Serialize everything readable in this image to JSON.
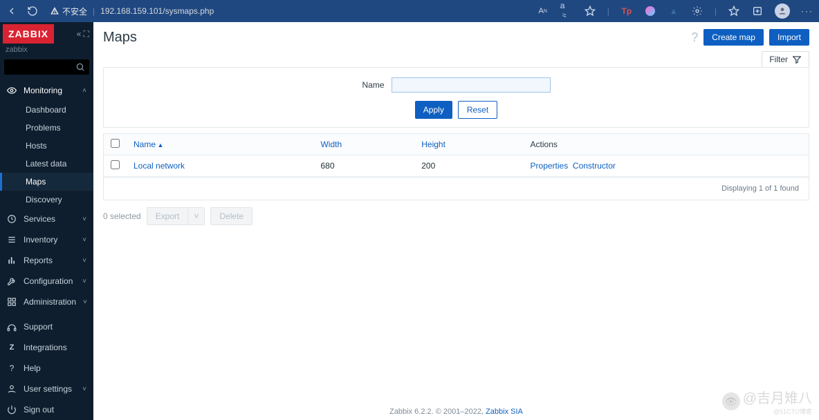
{
  "browser": {
    "security_label": "不安全",
    "url": "192.168.159.101/sysmaps.php"
  },
  "brand": {
    "logo": "ZABBIX",
    "tenant": "zabbix"
  },
  "search": {
    "placeholder": ""
  },
  "nav": {
    "monitoring": {
      "label": "Monitoring",
      "items": {
        "dashboard": "Dashboard",
        "problems": "Problems",
        "hosts": "Hosts",
        "latest": "Latest data",
        "maps": "Maps",
        "discovery": "Discovery"
      }
    },
    "services": "Services",
    "inventory": "Inventory",
    "reports": "Reports",
    "configuration": "Configuration",
    "administration": "Administration",
    "support": "Support",
    "integrations": "Integrations",
    "help": "Help",
    "user_settings": "User settings",
    "sign_out": "Sign out"
  },
  "page": {
    "title": "Maps",
    "create_btn": "Create map",
    "import_btn": "Import"
  },
  "filter": {
    "tab_label": "Filter",
    "name_label": "Name",
    "name_value": "",
    "apply": "Apply",
    "reset": "Reset"
  },
  "table": {
    "headers": {
      "name": "Name",
      "width": "Width",
      "height": "Height",
      "actions": "Actions"
    },
    "rows": [
      {
        "name": "Local network",
        "width": "680",
        "height": "200",
        "action_properties": "Properties",
        "action_constructor": "Constructor"
      }
    ],
    "footer": "Displaying 1 of 1 found"
  },
  "bulk": {
    "selected": "0 selected",
    "export": "Export",
    "delete": "Delete"
  },
  "footer": {
    "text": "Zabbix 6.2.2. © 2001–2022, ",
    "link": "Zabbix SIA"
  },
  "watermark": {
    "text": "@吉月雉八",
    "sub": "@51CTO博客"
  }
}
